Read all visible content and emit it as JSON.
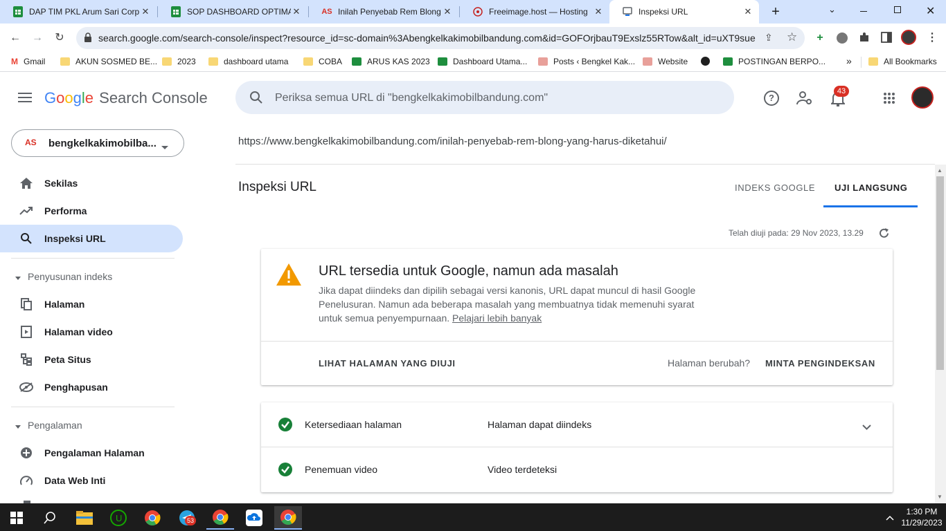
{
  "browser": {
    "tabs": [
      {
        "title": "DAP TIM PKL Arum Sari Corp",
        "icon": "sheets-icon"
      },
      {
        "title": "SOP DASHBOARD OPTIMASI",
        "icon": "sheets-icon"
      },
      {
        "title": "Inilah Penyebab Rem Blong",
        "icon": "as-logo-icon"
      },
      {
        "title": "Freeimage.host — Hosting",
        "icon": "freeimage-icon"
      },
      {
        "title": "Inspeksi URL",
        "icon": "search-console-icon"
      }
    ],
    "url": "search.google.com/search-console/inspect?resource_id=sc-domain%3Abengkelkakimobilbandung.com&id=GOFOrjbauT9Exslz55RTow&alt_id=uXT9sue...",
    "bookmarks": [
      "Gmail",
      "AKUN SOSMED BE...",
      "2023",
      "dashboard utama",
      "COBA",
      "ARUS KAS 2023",
      "Dashboard Utama...",
      "Posts ‹ Bengkel Kak...",
      "Website",
      "POSTINGAN BERPO..."
    ],
    "all_bookmarks": "All Bookmarks",
    "more_glyph": "»"
  },
  "header": {
    "logo_google": "Google",
    "logo_product": "Search Console",
    "search_placeholder": "Periksa semua URL di \"bengkelkakimobilbandung.com\"",
    "notification_count": "43"
  },
  "sidebar": {
    "property_badge": "AS",
    "property": "bengkelkakimobilba...",
    "items_top": [
      {
        "label": "Sekilas",
        "icon": "home-icon"
      },
      {
        "label": "Performa",
        "icon": "trending-up-icon"
      },
      {
        "label": "Inspeksi URL",
        "icon": "search-icon"
      }
    ],
    "section_index": "Penyusunan indeks",
    "items_index": [
      {
        "label": "Halaman",
        "icon": "pages-icon"
      },
      {
        "label": "Halaman video",
        "icon": "video-page-icon"
      },
      {
        "label": "Peta Situs",
        "icon": "sitemap-icon"
      },
      {
        "label": "Penghapusan",
        "icon": "removal-icon"
      }
    ],
    "section_experience": "Pengalaman",
    "items_experience": [
      {
        "label": "Pengalaman Halaman",
        "icon": "add-circle-icon"
      },
      {
        "label": "Data Web Inti",
        "icon": "speed-icon"
      }
    ]
  },
  "main": {
    "inspected_url": "https://www.bengkelkakimobilbandung.com/inilah-penyebab-rem-blong-yang-harus-diketahui/",
    "title": "Inspeksi URL",
    "tabs": [
      "INDEKS GOOGLE",
      "UJI LANGSUNG"
    ],
    "tested_at": "Telah diuji pada: 29 Nov 2023, 13.29",
    "status_card": {
      "heading": "URL tersedia untuk Google, namun ada masalah",
      "body": "Jika dapat diindeks dan dipilih sebagai versi kanonis, URL dapat muncul di hasil Google Penelusuran. Namun ada beberapa masalah yang membuatnya tidak memenuhi syarat untuk semua penyempurnaan.",
      "learn_more": "Pelajari lebih banyak",
      "view_tested": "LIHAT HALAMAN YANG DIUJI",
      "page_changed": "Halaman berubah?",
      "request_indexing": "MINTA PENGINDEKSAN"
    },
    "results": [
      {
        "label": "Ketersediaan halaman",
        "value": "Halaman dapat diindeks"
      },
      {
        "label": "Penemuan video",
        "value": "Video terdeteksi"
      }
    ]
  },
  "taskbar": {
    "time": "1:30 PM",
    "date": "11/29/2023",
    "telegram_badge": "53"
  },
  "colors": {
    "google_blue": "#4285f4",
    "google_red": "#ea4335",
    "google_yellow": "#fbbc04",
    "google_green": "#34a853",
    "warning": "#f29900",
    "success": "#188038",
    "active_tab_underline": "#1a73e8"
  }
}
